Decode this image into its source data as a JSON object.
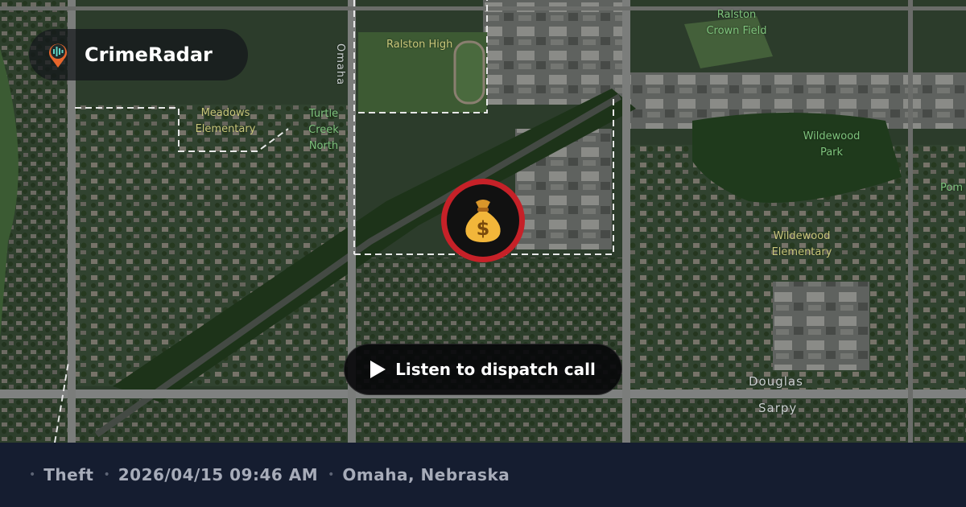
{
  "app": {
    "name": "CrimeRadar"
  },
  "map": {
    "labels": {
      "ralston_high": "Ralston High",
      "ralston_crown_field": "Ralston Crown Field",
      "meadows_elementary": "Meadows Elementary",
      "turtle_creek_north": "Turtle Creek North",
      "omaha_road": "Omaha",
      "wildewood_park": "Wildewood Park",
      "wildewood_elementary": "Wildewood Elementary",
      "douglas": "Douglas",
      "sarpy": "Sarpy",
      "pom": "Pom"
    },
    "marker_icon": "money-bag-icon"
  },
  "actions": {
    "listen_label": "Listen to dispatch call"
  },
  "incident": {
    "type": "Theft",
    "datetime": "2026/04/15 09:46 AM",
    "location": "Omaha, Nebraska",
    "separator": "•"
  },
  "colors": {
    "marker_ring": "#c62128",
    "footer_bg": "#151d30",
    "footer_text": "#a7acb9",
    "brand_accent": "#e8662c"
  }
}
